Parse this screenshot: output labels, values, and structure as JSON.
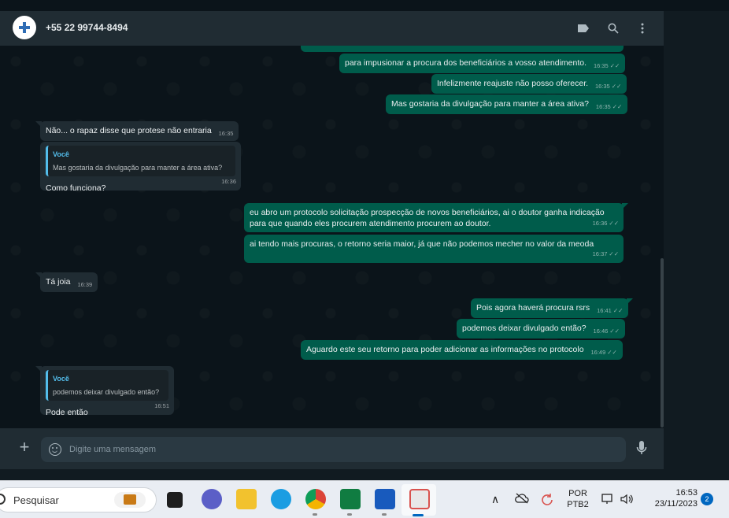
{
  "header": {
    "contact": "+55 22 99744-8494",
    "icons": [
      "label-icon",
      "search-icon",
      "kebab-menu-icon"
    ]
  },
  "messages": [
    {
      "dir": "out",
      "text": "para impusionar a procura dos beneficiários a vosso atendimento.",
      "time": "16:35"
    },
    {
      "dir": "out",
      "text": "Infelizmente reajuste não posso oferecer.",
      "time": "16:35"
    },
    {
      "dir": "out",
      "text": "Mas gostaria da divulgação para manter a área ativa?",
      "time": "16:35"
    },
    {
      "dir": "in",
      "text": "Não... o rapaz disse que protese não entraria",
      "time": "16:35"
    },
    {
      "dir": "in",
      "quote_author": "Você",
      "quote_text": "Mas gostaria da divulgação para manter a área ativa?",
      "text": "Como funciona?",
      "time": "16:36"
    },
    {
      "dir": "out",
      "text": "eu abro um protocolo solicitação prospecção de novos beneficiários, ai o doutor ganha indicação para que quando eles procurem atendimento procurem ao doutor.",
      "time": "16:36"
    },
    {
      "dir": "out",
      "text": "ai tendo mais procuras, o retorno seria maior, já que não podemos mecher no valor da meoda",
      "time": "16:37"
    },
    {
      "dir": "in",
      "text": "Tá joia",
      "time": "16:39"
    },
    {
      "dir": "out",
      "text": "Pois agora haverá procura rsrs",
      "time": "16:41"
    },
    {
      "dir": "out",
      "text": "podemos deixar divulgado então?",
      "time": "16:46"
    },
    {
      "dir": "out",
      "text": "Aguardo este seu retorno para poder adicionar as informações no protocolo",
      "time": "16:49"
    },
    {
      "dir": "in",
      "quote_author": "Você",
      "quote_text": "podemos deixar divulgado então?",
      "text": "Pode então",
      "time": "16:51"
    }
  ],
  "composer": {
    "placeholder": "Digite uma mensagem"
  },
  "taskbar": {
    "search_label": "Pesquisar",
    "language": "POR",
    "layout": "PTB2",
    "time": "16:53",
    "date": "23/11/2023",
    "notifications": "2"
  },
  "colors": {
    "outgoing_bubble": "#005c4b",
    "incoming_bubble": "#202c33",
    "quote_accent": "#53bdeb",
    "chat_background": "#0b141a"
  }
}
